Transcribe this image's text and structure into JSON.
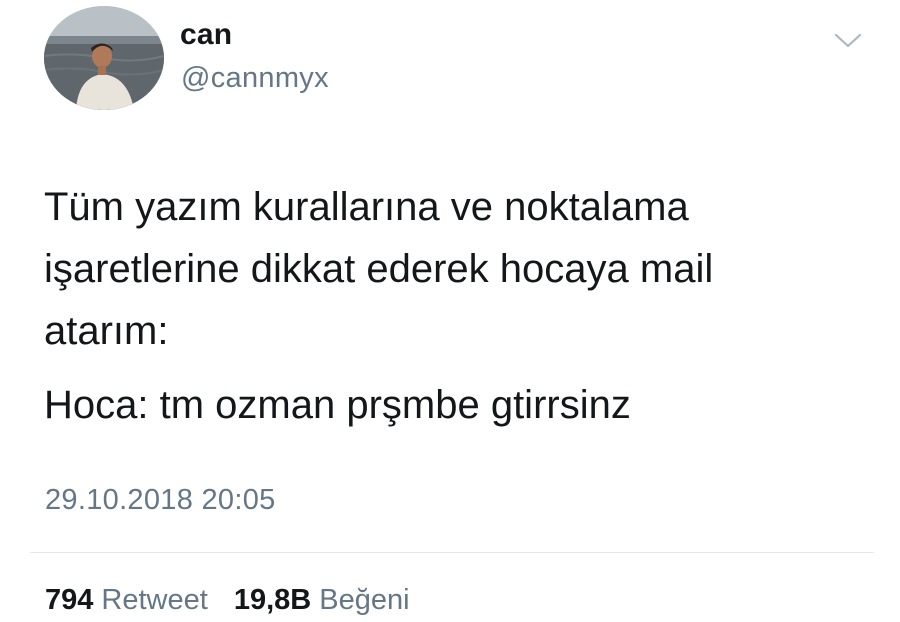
{
  "user": {
    "display_name": "can",
    "handle": "@cannmyx"
  },
  "tweet": {
    "lines": [
      "Tüm yazım kurallarına ve noktalama",
      "işaretlerine dikkat ederek hocaya mail",
      "atarım:",
      "Hoca: tm ozman prşmbe gtirrsinz"
    ],
    "timestamp": "29.10.2018 20:05"
  },
  "stats": {
    "retweets": {
      "count": "794",
      "label": "Retweet"
    },
    "likes": {
      "count": "19,8B",
      "label": "Beğeni"
    }
  },
  "icons": {
    "caret": "chevron-down-icon"
  },
  "colors": {
    "text_primary": "#14171a",
    "text_secondary": "#657786",
    "divider": "#e1e8ed"
  }
}
